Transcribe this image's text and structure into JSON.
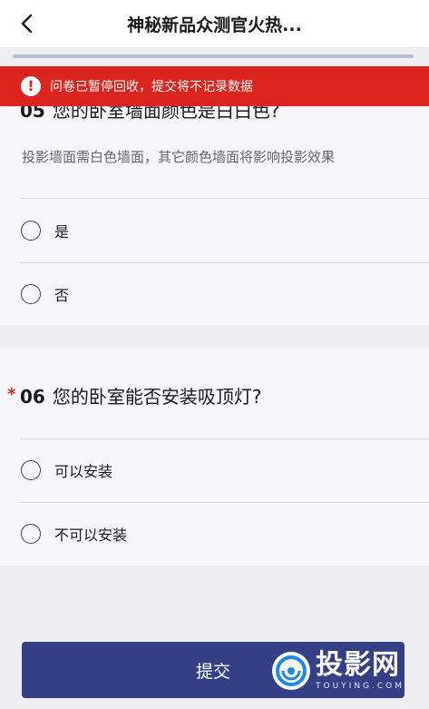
{
  "header": {
    "title": "神秘新品众测官火热..."
  },
  "banner": {
    "text": "问卷已暂停回收，提交将不记录数据",
    "color": "#dc241f"
  },
  "questions": [
    {
      "number": "05",
      "title": "您的卧室墙面颜色是白白色?",
      "description": "投影墙面需白色墙面，其它颜色墙面将影响投影效果",
      "options": [
        "是",
        "否"
      ]
    },
    {
      "number": "06",
      "required_mark": "*",
      "title": "您的卧室能否安装吸顶灯?",
      "options": [
        "可以安装",
        "不可以安装"
      ]
    }
  ],
  "submit": {
    "label": "提交",
    "color": "#343f86"
  },
  "watermark": {
    "main": "投影网",
    "sub": "TOUYING.COM"
  }
}
